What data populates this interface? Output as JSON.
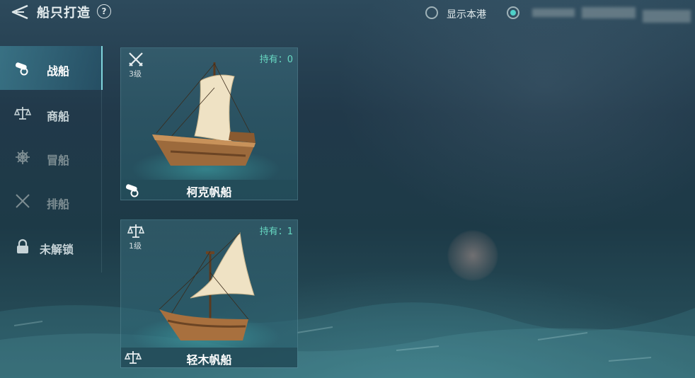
{
  "header": {
    "title": "船只打造",
    "help": "?",
    "filter_label": "显示本港"
  },
  "sidebar": {
    "items": [
      {
        "label": "战船",
        "icon": "cannon-icon",
        "state": "active"
      },
      {
        "label": "商船",
        "icon": "scales-icon",
        "state": "normal"
      },
      {
        "label": "冒船",
        "icon": "ship-wheel-icon",
        "state": "dim"
      },
      {
        "label": "排船",
        "icon": "crossed-swords-icon",
        "state": "dim"
      },
      {
        "label": "未解锁",
        "icon": "lock-icon",
        "state": "normal"
      }
    ]
  },
  "ships": [
    {
      "name": "柯克帆船",
      "owned": "持有：0",
      "level": "3级",
      "tier_icon": "crossed-swords-icon",
      "type_icon": "cannon-icon"
    },
    {
      "name": "轻木帆船",
      "owned": "持有：1",
      "level": "1级",
      "tier_icon": "scales-icon",
      "type_icon": "scales-icon"
    }
  ],
  "colors": {
    "accent": "#4fd1c9",
    "owned_text": "#67d8c2",
    "active_tab": "#3f8fa5"
  }
}
